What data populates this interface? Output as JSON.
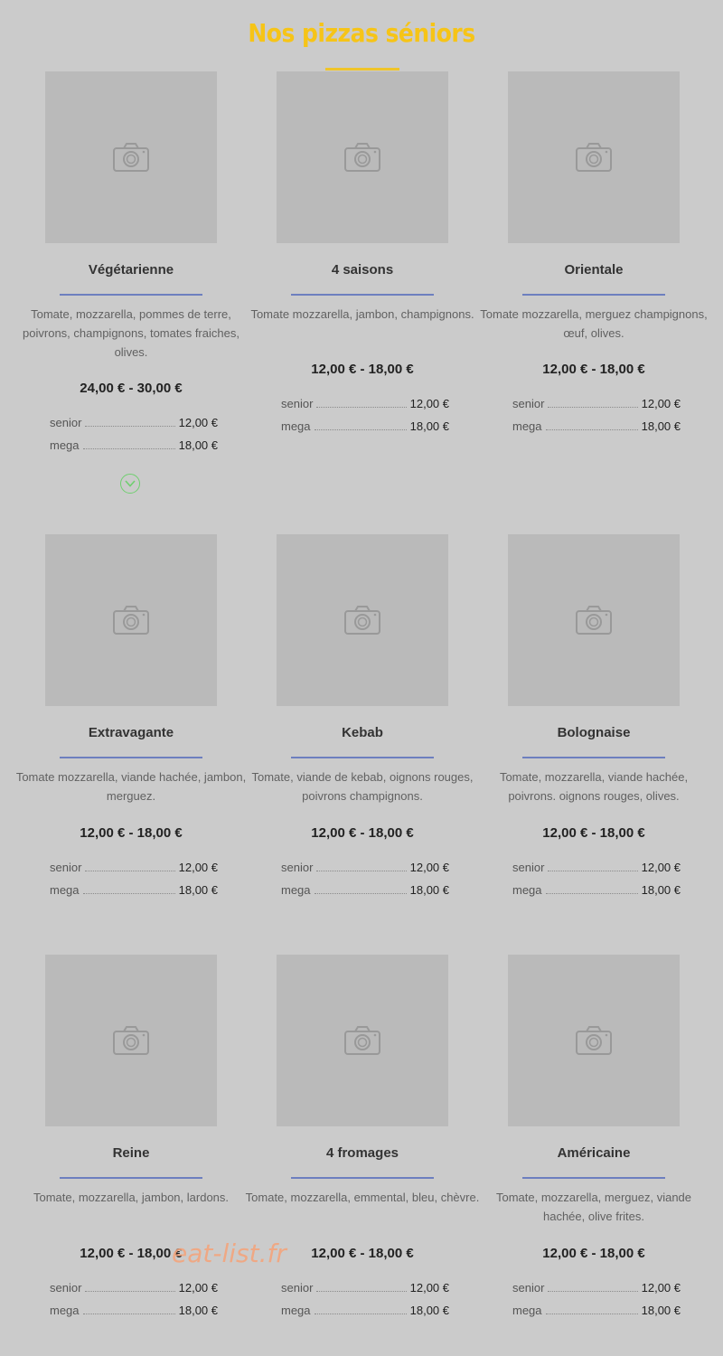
{
  "page": {
    "title": "Nos pizzas séniors",
    "accent_color": "#f6c417",
    "separator_color": "#6d7fbf"
  },
  "pizzas": [
    {
      "name": "Végétarienne",
      "description": "Tomate, mozzarella, pommes de terre, poivrons, champignons, tomates fraiches, olives.",
      "price_range": "24,00 € - 30,00 €",
      "prices": [
        {
          "size": "senior",
          "amount": "12,00 €"
        },
        {
          "size": "mega",
          "amount": "18,00 €"
        }
      ]
    },
    {
      "name": "4 saisons",
      "description": "Tomate mozzarella, jambon, champignons.",
      "price_range": "12,00 € - 18,00 €",
      "prices": [
        {
          "size": "senior",
          "amount": "12,00 €"
        },
        {
          "size": "mega",
          "amount": "18,00 €"
        }
      ]
    },
    {
      "name": "Orientale",
      "description": "Tomate mozzarella, merguez champignons, œuf, olives.",
      "price_range": "12,00 € - 18,00 €",
      "prices": [
        {
          "size": "senior",
          "amount": "12,00 €"
        },
        {
          "size": "mega",
          "amount": "18,00 €"
        }
      ]
    },
    {
      "name": "Extravagante",
      "description": "Tomate mozzarella, viande hachée, jambon, merguez.",
      "price_range": "12,00 € - 18,00 €",
      "prices": [
        {
          "size": "senior",
          "amount": "12,00 €"
        },
        {
          "size": "mega",
          "amount": "18,00 €"
        }
      ]
    },
    {
      "name": "Kebab",
      "description": "Tomate, viande de kebab, oignons rouges, poivrons champignons.",
      "price_range": "12,00 € - 18,00 €",
      "prices": [
        {
          "size": "senior",
          "amount": "12,00 €"
        },
        {
          "size": "mega",
          "amount": "18,00 €"
        }
      ]
    },
    {
      "name": "Bolognaise",
      "description": "Tomate, mozzarella, viande hachée, poivrons. oignons rouges, olives.",
      "price_range": "12,00 € - 18,00 €",
      "prices": [
        {
          "size": "senior",
          "amount": "12,00 €"
        },
        {
          "size": "mega",
          "amount": "18,00 €"
        }
      ]
    },
    {
      "name": "Reine",
      "description": "Tomate, mozzarella, jambon, lardons.",
      "price_range": "12,00 € - 18,00 €",
      "prices": [
        {
          "size": "senior",
          "amount": "12,00 €"
        },
        {
          "size": "mega",
          "amount": "18,00 €"
        }
      ]
    },
    {
      "name": "4 fromages",
      "description": "Tomate, mozzarella, emmental, bleu, chèvre.",
      "price_range": "12,00 € - 18,00 €",
      "prices": [
        {
          "size": "senior",
          "amount": "12,00 €"
        },
        {
          "size": "mega",
          "amount": "18,00 €"
        }
      ]
    },
    {
      "name": "Américaine",
      "description": "Tomate, mozzarella, merguez, viande hachée, olive frites.",
      "price_range": "12,00 € - 18,00 €",
      "prices": [
        {
          "size": "senior",
          "amount": "12,00 €"
        },
        {
          "size": "mega",
          "amount": "18,00 €"
        }
      ]
    }
  ],
  "icons": {
    "photo_placeholder": "camera-icon",
    "expand": "chevron-down-icon"
  },
  "watermark": "eat-list.fr"
}
